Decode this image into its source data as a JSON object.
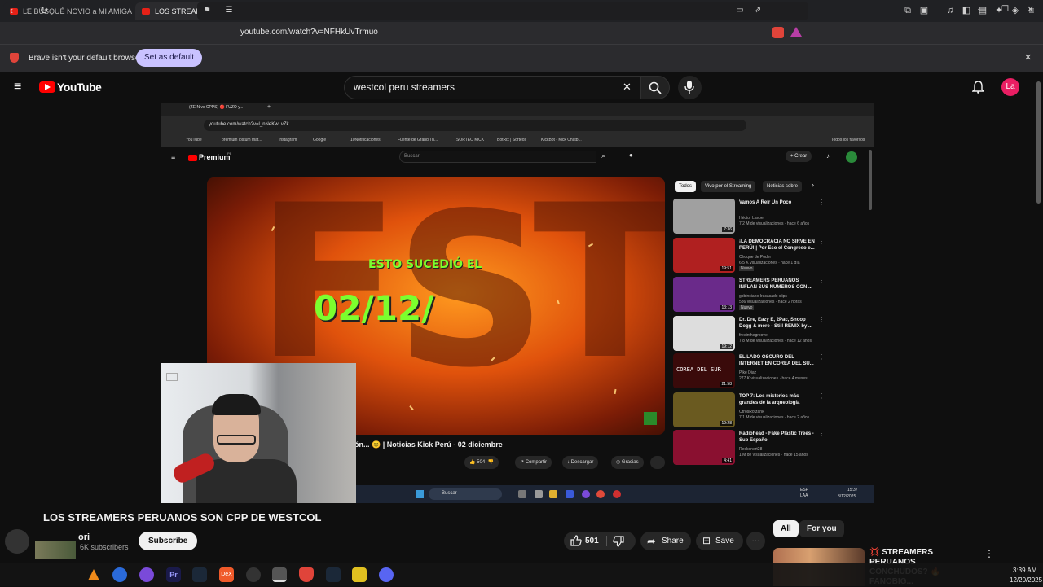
{
  "browser": {
    "tabs": [
      {
        "label": "LE BUSQUÉ NOVIO a MI AMIGA BRA..."
      },
      {
        "label": "LOS STREAMERS PERUANOS SO..."
      }
    ],
    "url": "youtube.com/watch?v=NFHkUvTrmuo",
    "infobar_text": "Brave isn't your default browser",
    "set_default_label": "Set as default"
  },
  "youtube": {
    "logo_text": "YouTube",
    "search_value": "westcol peru streamers",
    "avatar_letter": "La"
  },
  "video": {
    "inner_browser": {
      "tab_label": "(ZEIN vs CPPS) 🔴 FUZO y...",
      "url": "youtube.com/watch?v=l_nNeKwLvZk",
      "bookmarks": [
        "YouTube",
        "premium iostum mat...",
        "Instagram",
        "Google",
        "10Notificaciones",
        "Fuente de Grand Th...",
        "SORTEO KICK",
        "BotRix | Sorteos",
        "KickBot - Kick Chatb...",
        "Todos los favoritos"
      ],
      "logo_text": "Premium",
      "logo_sup": "PE",
      "search_placeholder": "Buscar",
      "create_label": "Crear"
    },
    "thumbnail": {
      "line1": "ESTO SUCEDIÓ EL",
      "line2": "02/12/"
    },
    "inner_title": "ón... 😊 | Noticias Kick Perú - 02 diciembre",
    "inner_actions": {
      "likes": "504",
      "share": "Compartir",
      "download": "Descargar",
      "thanks": "Gracias"
    },
    "chips": [
      "Todos",
      "Vivo por el Streaming",
      "Noticias sobre"
    ],
    "recommendations": [
      {
        "title": "Vamos A Reír Un Poco",
        "channel": "Héctor Lavoe",
        "meta": "7,2 M de visualizaciones · hace 6 años",
        "duration": "7:36",
        "color": "#a0a0a0"
      },
      {
        "title": "¡LA DEMOCRACIA NO SIRVE EN PERÚ! | Por Eso el Congreso e...",
        "channel": "Choque de Poder",
        "meta": "6,5 K visualizaciones · hace 1 día",
        "badge": "Nuevo",
        "duration": "19:51",
        "color": "#b02020"
      },
      {
        "title": "STREAMERS PERUANOS INFLAN SUS NUMEROS CON ...",
        "channel": "gobinciano Iracasado clips",
        "meta": "586 visualizaciones · hace 2 horas",
        "badge": "Nuevo",
        "duration": "13:13",
        "color": "#6a2a8a"
      },
      {
        "title": "Dr. Dre, Eazy E, 2Pac, Snoop Dogg & more - Still REMIX by ...",
        "channel": "freeinthegroove",
        "meta": "7,8 M de visualizaciones · hace 12 años",
        "duration": "19:12",
        "color": "#dddddd"
      },
      {
        "title": "EL LADO OSCURO DEL INTERNET EN COREA DEL SU...",
        "channel": "Pike Diaz",
        "meta": "277 K visualizaciones · hace 4 meses",
        "duration": "21:58",
        "color": "#3a0a0a",
        "thumb_text": "COREA DEL SUR"
      },
      {
        "title": "TOP 7: Los misterios más grandes de la arqueología",
        "channel": "OtrosRotzank",
        "meta": "7,1 M de visualizaciones · hace 2 años",
        "duration": "19:28",
        "color": "#6a5a20"
      },
      {
        "title": "Radiohead - Fake Plastic Trees - Sub Español",
        "channel": "Reckonert28",
        "meta": "1 M de visualizaciones · hace 15 años",
        "duration": "4:41",
        "color": "#8a1030"
      }
    ],
    "inner_taskbar": {
      "search": "Buscar",
      "lang": "ESP LAA",
      "time": "15:37",
      "date": "3/12/2025"
    }
  },
  "page": {
    "title": "LOS STREAMERS PERUANOS SON CPP DE WESTCOL",
    "channel_name": "ori",
    "subscribers": "6K subscribers",
    "subscribe_label": "Subscribe",
    "likes": "501",
    "share_label": "Share",
    "save_label": "Save",
    "side_chips": [
      "All",
      "For you"
    ],
    "side_video_title": "💢 STREAMERS PERUANOS CONCHUDOS? 🔥 FANOBIG..."
  },
  "os": {
    "time": "3:39 AM",
    "date": "12/20/2025"
  }
}
